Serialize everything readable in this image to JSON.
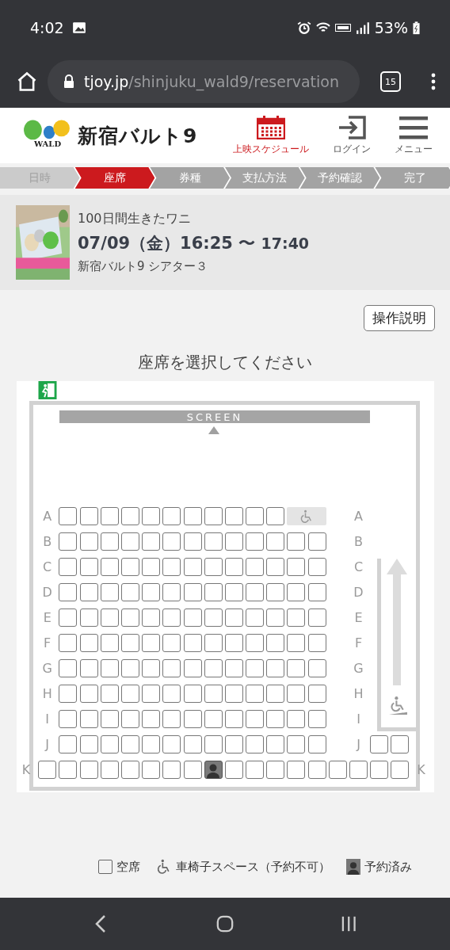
{
  "status_bar": {
    "time": "4:02",
    "battery": "53%"
  },
  "browser": {
    "url_host": "tjoy.jp",
    "url_path": "/shinjuku_wald9/reservation",
    "tab_count": "15"
  },
  "header": {
    "logo_mark": "WALD",
    "logo_text": "新宿バルト9",
    "nav": [
      {
        "kind": "calendar",
        "label": "上映スケジュール",
        "selected": true
      },
      {
        "kind": "login",
        "label": "ログイン",
        "selected": false
      },
      {
        "kind": "menu",
        "label": "メニュー",
        "selected": false
      }
    ]
  },
  "steps": [
    {
      "label": "日時",
      "selected": false,
      "done": true
    },
    {
      "label": "座席",
      "selected": true,
      "done": false
    },
    {
      "label": "券種",
      "selected": false,
      "done": false
    },
    {
      "label": "支払方法",
      "selected": false,
      "done": false
    },
    {
      "label": "予約確認",
      "selected": false,
      "done": false
    },
    {
      "label": "完了",
      "selected": false,
      "done": false
    }
  ],
  "movie": {
    "title": "100日間生きたワニ",
    "start": "07/09（金）16:25 〜",
    "end": "17:40",
    "theater": "新宿バルト9 シアター３"
  },
  "help_button": "操作説明",
  "instruction": "座席を選択してください",
  "seat_map": {
    "screen_label": "SCREEN",
    "rows": [
      {
        "label_left": "A",
        "label_right": "A",
        "seats": [
          {
            "kind": "available"
          },
          {
            "kind": "available"
          },
          {
            "kind": "available"
          },
          {
            "kind": "available"
          },
          {
            "kind": "available"
          },
          {
            "kind": "available"
          },
          {
            "kind": "available"
          },
          {
            "kind": "available"
          },
          {
            "kind": "available"
          },
          {
            "kind": "available"
          },
          {
            "kind": "available"
          },
          {
            "kind": "wheelchair"
          }
        ]
      },
      {
        "label_left": "B",
        "label_right": "B",
        "seats": [
          {
            "kind": "available"
          },
          {
            "kind": "available"
          },
          {
            "kind": "available"
          },
          {
            "kind": "available"
          },
          {
            "kind": "available"
          },
          {
            "kind": "available"
          },
          {
            "kind": "available"
          },
          {
            "kind": "available"
          },
          {
            "kind": "available"
          },
          {
            "kind": "available"
          },
          {
            "kind": "available"
          },
          {
            "kind": "available"
          },
          {
            "kind": "available"
          }
        ]
      },
      {
        "label_left": "C",
        "label_right": "C",
        "seats": [
          {
            "kind": "available"
          },
          {
            "kind": "available"
          },
          {
            "kind": "available"
          },
          {
            "kind": "available"
          },
          {
            "kind": "available"
          },
          {
            "kind": "available"
          },
          {
            "kind": "available"
          },
          {
            "kind": "available"
          },
          {
            "kind": "available"
          },
          {
            "kind": "available"
          },
          {
            "kind": "available"
          },
          {
            "kind": "available"
          },
          {
            "kind": "available"
          }
        ]
      },
      {
        "label_left": "D",
        "label_right": "D",
        "seats": [
          {
            "kind": "available"
          },
          {
            "kind": "available"
          },
          {
            "kind": "available"
          },
          {
            "kind": "available"
          },
          {
            "kind": "available"
          },
          {
            "kind": "available"
          },
          {
            "kind": "available"
          },
          {
            "kind": "available"
          },
          {
            "kind": "available"
          },
          {
            "kind": "available"
          },
          {
            "kind": "available"
          },
          {
            "kind": "available"
          },
          {
            "kind": "available"
          }
        ]
      },
      {
        "label_left": "E",
        "label_right": "E",
        "seats": [
          {
            "kind": "available"
          },
          {
            "kind": "available"
          },
          {
            "kind": "available"
          },
          {
            "kind": "available"
          },
          {
            "kind": "available"
          },
          {
            "kind": "available"
          },
          {
            "kind": "available"
          },
          {
            "kind": "available"
          },
          {
            "kind": "available"
          },
          {
            "kind": "available"
          },
          {
            "kind": "available"
          },
          {
            "kind": "available"
          },
          {
            "kind": "available"
          }
        ]
      },
      {
        "label_left": "F",
        "label_right": "F",
        "seats": [
          {
            "kind": "available"
          },
          {
            "kind": "available"
          },
          {
            "kind": "available"
          },
          {
            "kind": "available"
          },
          {
            "kind": "available"
          },
          {
            "kind": "available"
          },
          {
            "kind": "available"
          },
          {
            "kind": "available"
          },
          {
            "kind": "available"
          },
          {
            "kind": "available"
          },
          {
            "kind": "available"
          },
          {
            "kind": "available"
          },
          {
            "kind": "available"
          }
        ]
      },
      {
        "label_left": "G",
        "label_right": "G",
        "seats": [
          {
            "kind": "available"
          },
          {
            "kind": "available"
          },
          {
            "kind": "available"
          },
          {
            "kind": "available"
          },
          {
            "kind": "available"
          },
          {
            "kind": "available"
          },
          {
            "kind": "available"
          },
          {
            "kind": "available"
          },
          {
            "kind": "available"
          },
          {
            "kind": "available"
          },
          {
            "kind": "available"
          },
          {
            "kind": "available"
          },
          {
            "kind": "available"
          }
        ]
      },
      {
        "label_left": "H",
        "label_right": "H",
        "seats": [
          {
            "kind": "available"
          },
          {
            "kind": "available"
          },
          {
            "kind": "available"
          },
          {
            "kind": "available"
          },
          {
            "kind": "available"
          },
          {
            "kind": "available"
          },
          {
            "kind": "available"
          },
          {
            "kind": "available"
          },
          {
            "kind": "available"
          },
          {
            "kind": "available"
          },
          {
            "kind": "available"
          },
          {
            "kind": "available"
          },
          {
            "kind": "available"
          }
        ]
      },
      {
        "label_left": "I",
        "label_right": "I",
        "seats": [
          {
            "kind": "available"
          },
          {
            "kind": "available"
          },
          {
            "kind": "available"
          },
          {
            "kind": "available"
          },
          {
            "kind": "available"
          },
          {
            "kind": "available"
          },
          {
            "kind": "available"
          },
          {
            "kind": "available"
          },
          {
            "kind": "available"
          },
          {
            "kind": "available"
          },
          {
            "kind": "available"
          },
          {
            "kind": "available"
          },
          {
            "kind": "available"
          }
        ]
      },
      {
        "label_left": "J",
        "label_right": "J",
        "seats": [
          {
            "kind": "available"
          },
          {
            "kind": "available"
          },
          {
            "kind": "available"
          },
          {
            "kind": "available"
          },
          {
            "kind": "available"
          },
          {
            "kind": "available"
          },
          {
            "kind": "available"
          },
          {
            "kind": "available"
          },
          {
            "kind": "available"
          },
          {
            "kind": "available"
          },
          {
            "kind": "available"
          },
          {
            "kind": "available"
          },
          {
            "kind": "available"
          }
        ],
        "extra_seats": [
          {
            "kind": "available"
          },
          {
            "kind": "available"
          }
        ]
      }
    ],
    "back_row": {
      "label_left": "K",
      "label_right": "K",
      "seats": [
        {
          "kind": "available"
        },
        {
          "kind": "available"
        },
        {
          "kind": "available"
        },
        {
          "kind": "available"
        },
        {
          "kind": "available"
        },
        {
          "kind": "available"
        },
        {
          "kind": "available"
        },
        {
          "kind": "available"
        },
        {
          "kind": "reserved"
        },
        {
          "kind": "available"
        },
        {
          "kind": "available"
        },
        {
          "kind": "available"
        },
        {
          "kind": "available"
        },
        {
          "kind": "available"
        },
        {
          "kind": "available"
        },
        {
          "kind": "available"
        },
        {
          "kind": "available"
        },
        {
          "kind": "available"
        }
      ]
    }
  },
  "legend": [
    {
      "kind": "available",
      "label": "空席"
    },
    {
      "kind": "wheelchair",
      "label": "車椅子スペース（予約不可）"
    },
    {
      "kind": "reserved",
      "label": "予約済み"
    }
  ]
}
